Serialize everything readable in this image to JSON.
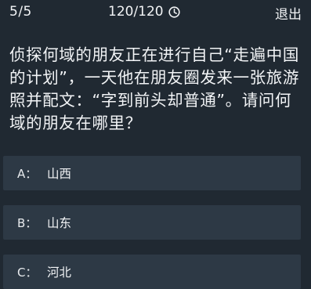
{
  "header": {
    "progress": "5/5",
    "timer": "120/120",
    "timer_icon": "clock-icon",
    "exit_label": "退出"
  },
  "question": {
    "text": "侦探何域的朋友正在进行自己“走遍中国的计划”，一天他在朋友圈发来一张旅游照并配文：“字到前头却普通”。请问何域的朋友在哪里？"
  },
  "options": [
    {
      "letter": "A：",
      "text": "山西"
    },
    {
      "letter": "B：",
      "text": "山东"
    },
    {
      "letter": "C：",
      "text": "河北"
    }
  ],
  "colors": {
    "background": "#202932",
    "option_background": "#2d3945",
    "text": "#f2f4f6"
  }
}
